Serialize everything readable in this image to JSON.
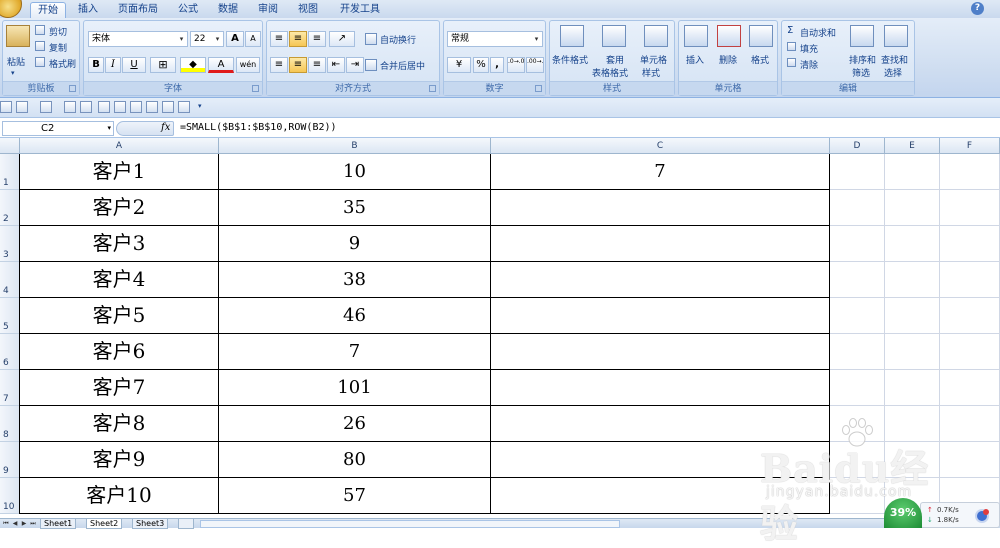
{
  "ribbon_tabs": [
    "开始",
    "插入",
    "页面布局",
    "公式",
    "数据",
    "审阅",
    "视图",
    "开发工具"
  ],
  "active_tab": "开始",
  "help_glyph": "?",
  "clipboard": {
    "paste": "粘贴",
    "cut": "剪切",
    "copy": "复制",
    "format_painter": "格式刷",
    "group_label": "剪贴板"
  },
  "font": {
    "name": "宋体",
    "size": "22",
    "bold": "B",
    "italic": "I",
    "underline": "U",
    "grow": "A",
    "shrink": "A",
    "phonetic": "wén",
    "font_color_glyph": "A",
    "group_label": "字体"
  },
  "alignment": {
    "wrap_text": "自动换行",
    "merge_center": "合并后居中",
    "group_label": "对齐方式"
  },
  "number": {
    "format": "常规",
    "percent": "%",
    "comma": ",",
    "increase_decimal": ".0→.00",
    "decrease_decimal": ".00→.0",
    "group_label": "数字"
  },
  "styles": {
    "conditional": "条件格式",
    "table_line1": "套用",
    "table_line2": "表格格式",
    "cell_styles_line1": "单元格",
    "cell_styles_line2": "样式",
    "group_label": "样式"
  },
  "cells": {
    "insert": "插入",
    "delete": "删除",
    "format": "格式",
    "group_label": "单元格"
  },
  "editing": {
    "autosum": "自动求和",
    "fill": "填充",
    "clear": "清除",
    "sort_line1": "排序和",
    "sort_line2": "筛选",
    "find_line1": "查找和",
    "find_line2": "选择",
    "group_label": "编辑"
  },
  "formula_bar": {
    "name_box": "C2",
    "fx": "fx",
    "formula": "=SMALL($B$1:$B$10,ROW(B2))"
  },
  "columns": [
    "A",
    "B",
    "C",
    "D",
    "E",
    "F"
  ],
  "rows": [
    {
      "num": "1",
      "a": "客户1",
      "b": "10",
      "c": "7"
    },
    {
      "num": "2",
      "a": "客户2",
      "b": "35",
      "c": ""
    },
    {
      "num": "3",
      "a": "客户3",
      "b": "9",
      "c": ""
    },
    {
      "num": "4",
      "a": "客户4",
      "b": "38",
      "c": ""
    },
    {
      "num": "5",
      "a": "客户5",
      "b": "46",
      "c": ""
    },
    {
      "num": "6",
      "a": "客户6",
      "b": "7",
      "c": ""
    },
    {
      "num": "7",
      "a": "客户7",
      "b": "101",
      "c": ""
    },
    {
      "num": "8",
      "a": "客户8",
      "b": "26",
      "c": ""
    },
    {
      "num": "9",
      "a": "客户9",
      "b": "80",
      "c": ""
    },
    {
      "num": "10",
      "a": "客户10",
      "b": "57",
      "c": ""
    }
  ],
  "sheet_tabs": [
    "Sheet1",
    "Sheet2",
    "Sheet3"
  ],
  "active_sheet": "Sheet2",
  "watermark": {
    "brand": "Baidu经验",
    "url": "jingyan.baidu.com"
  },
  "net_widget": {
    "percent": "39%",
    "up": "0.7K/s",
    "down": "1.8K/s"
  }
}
